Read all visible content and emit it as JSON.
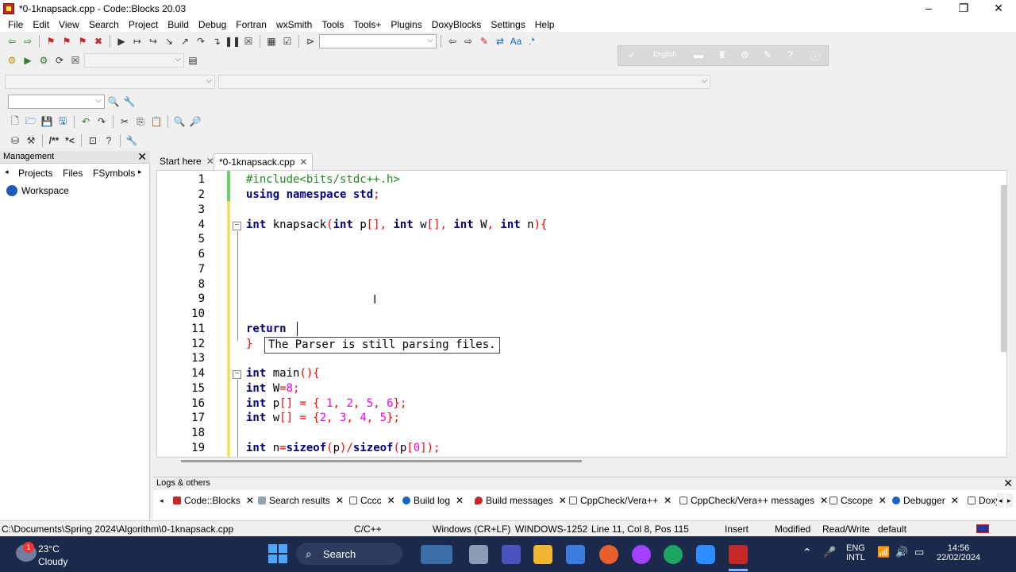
{
  "window": {
    "title": "*0-1knapsack.cpp - Code::Blocks 20.03",
    "minimize": "–",
    "maximize": "❐",
    "close": "✕"
  },
  "menu": [
    "File",
    "Edit",
    "View",
    "Search",
    "Project",
    "Build",
    "Debug",
    "Fortran",
    "wxSmith",
    "Tools",
    "Tools+",
    "Plugins",
    "DoxyBlocks",
    "Settings",
    "Help"
  ],
  "floatbar": {
    "language": "English"
  },
  "management": {
    "title": "Management",
    "close": "✕",
    "tabs": [
      "Projects",
      "Files",
      "FSymbols"
    ],
    "tree_root": "Workspace"
  },
  "editor_tabs": [
    {
      "label": "Start here",
      "close": "✕"
    },
    {
      "label": "*0-1knapsack.cpp",
      "close": "✕"
    }
  ],
  "code": {
    "line_numbers": [
      "1",
      "2",
      "3",
      "4",
      "5",
      "6",
      "7",
      "8",
      "9",
      "10",
      "11",
      "12",
      "13",
      "14",
      "15",
      "16",
      "17",
      "18",
      "19"
    ],
    "tooltip": "The Parser is still parsing files."
  },
  "logs": {
    "title": "Logs & others",
    "close": "✕",
    "tabs": [
      "Code::Blocks",
      "Search results",
      "Cccc",
      "Build log",
      "Build messages",
      "CppCheck/Vera++",
      "CppCheck/Vera++ messages",
      "Cscope",
      "Debugger",
      "Doxyl"
    ]
  },
  "status": {
    "path": "C:\\Documents\\Spring 2024\\Algorithm\\0-1knapsack.cpp",
    "language": "C/C++",
    "eol": "Windows (CR+LF)",
    "encoding": "WINDOWS-1252",
    "position": "Line 11, Col 8, Pos 115",
    "mode": "Insert",
    "modified": "Modified",
    "access": "Read/Write",
    "profile": "default"
  },
  "taskbar": {
    "temp": "23°C",
    "condition": "Cloudy",
    "weather_badge": "1",
    "search": "Search",
    "lang1": "ENG",
    "lang2": "INTL",
    "time": "14:56",
    "date": "22/02/2024"
  }
}
